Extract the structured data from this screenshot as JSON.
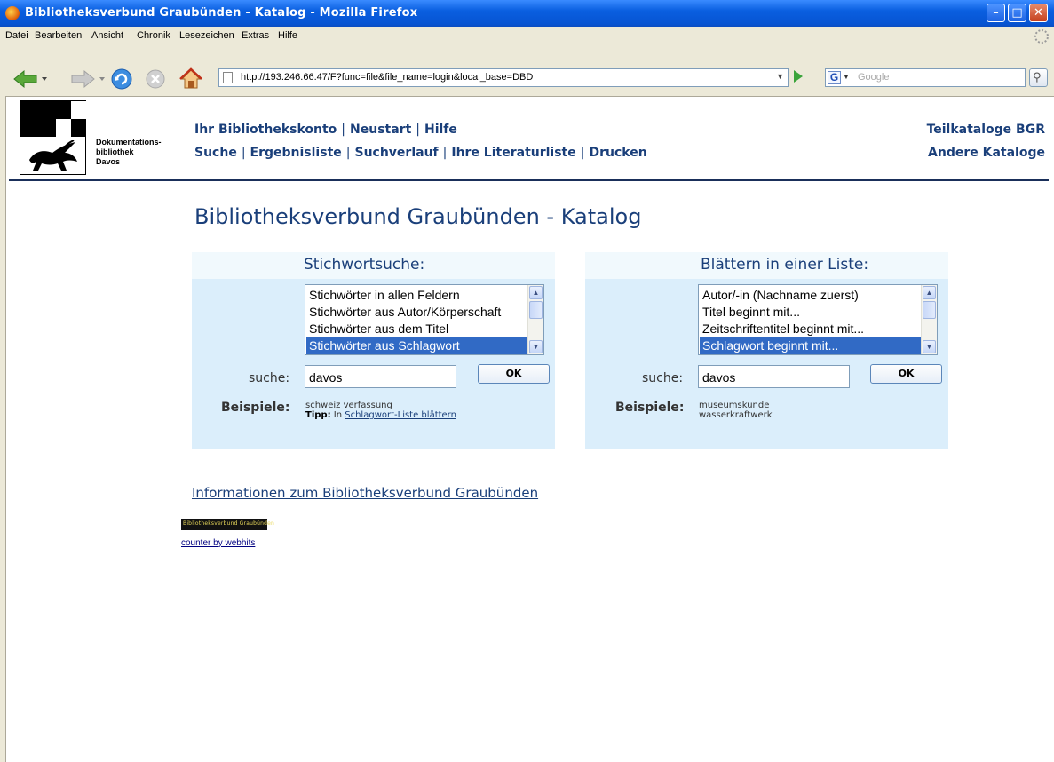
{
  "window": {
    "title": "Bibliotheksverbund Graubünden - Katalog - Mozilla Firefox"
  },
  "menu": [
    "Datei",
    "Bearbeiten",
    "Ansicht",
    "Chronik",
    "Lesezeichen",
    "Extras",
    "Hilfe"
  ],
  "toolbar": {
    "url": "http://193.246.66.47/F?func=file&file_name=login&local_base=DBD",
    "search_placeholder": "Google",
    "search_engine_icon": "G"
  },
  "logo": {
    "line1": "Dokumentations-",
    "line2": "bibliothek",
    "line3": "Davos"
  },
  "nav": {
    "row1": [
      "Ihr Bibliothekskonto",
      "Neustart",
      "Hilfe"
    ],
    "row2": [
      "Suche",
      "Ergebnisliste",
      "Suchverlauf",
      "Ihre Literaturliste",
      "Drucken"
    ],
    "right1": "Teilkataloge BGR",
    "right2": "Andere Kataloge",
    "separator": "|"
  },
  "page_title": "Bibliotheksverbund Graubünden - Katalog",
  "keyword_panel": {
    "heading": "Stichwortsuche:",
    "options": [
      "Stichwörter in allen Feldern",
      "Stichwörter aus Autor/Körperschaft",
      "Stichwörter aus dem Titel",
      "Stichwörter aus Schlagwort"
    ],
    "selected_index": 3,
    "search_label": "suche:",
    "search_value": "davos",
    "ok_label": "OK",
    "examples_label": "Beispiele:",
    "example1": "schweiz verfassung",
    "tip_label": "Tipp:",
    "tip_text": "In",
    "tip_link": "Schlagwort-Liste blättern"
  },
  "browse_panel": {
    "heading": "Blättern in einer Liste:",
    "options": [
      "Autor/-in (Nachname zuerst)",
      "Titel beginnt mit...",
      "Zeitschriftentitel beginnt mit...",
      "Schlagwort beginnt mit..."
    ],
    "selected_index": 3,
    "search_label": "suche:",
    "search_value": "davos",
    "ok_label": "OK",
    "examples_label": "Beispiele:",
    "example1": "museumskunde",
    "example2": "wasserkraftwerk"
  },
  "footer": {
    "info_link": "Informationen zum Bibliotheksverbund Graubünden",
    "counter_badge": "Bibliotheksverbund Graubünden",
    "counter_link": "counter by webhits"
  },
  "colors": {
    "link": "#1a3f7a",
    "panel_bg": "#dbeefb",
    "selection": "#316ac5"
  }
}
